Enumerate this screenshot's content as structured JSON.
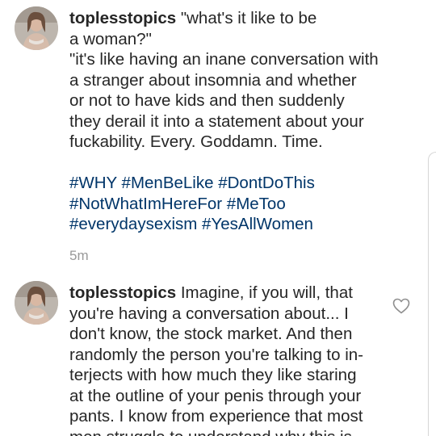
{
  "comments": [
    {
      "username": "toplesstopics",
      "text_lines": [
        "\"what's it like to be",
        "a woman?\"",
        "\"it's like having an inane conversation with",
        "a stranger about insomnia and whether",
        "or not to have kids and then suddenly",
        "they derail it into a statement about your",
        "fuckability. Every. Goddamn. Time."
      ],
      "hashtag_lines": [
        "#WHY #MenBeLike #DontDoThis",
        "#NotWhatImHereFor #MeToo",
        "#everydaysexism #YesAllWomen"
      ],
      "timestamp": "5m"
    },
    {
      "username": "toplesstopics",
      "text_lines": [
        "Imagine, if you will, that",
        "you're having a conversation about... I",
        "don't know, the stock market. And then",
        "randomly the person you're talking to in-",
        "terjects with how much they like staring",
        "at the outline of your penis through your",
        "pants. I know from experience that most",
        "men struggle to understand why this is"
      ]
    }
  ],
  "icons": {
    "like": "heart-outline-icon",
    "avatar": "profile-photo"
  },
  "colors": {
    "text": "#262626",
    "hashtag": "#003569",
    "timestamp": "#999999"
  }
}
